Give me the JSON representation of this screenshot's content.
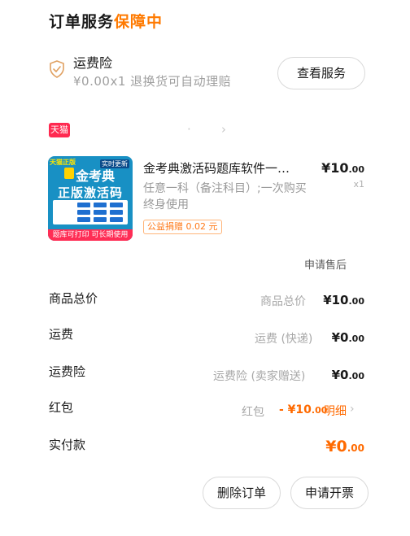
{
  "header": {
    "title_main": "订单服务",
    "title_accent": "保障中"
  },
  "insurance": {
    "name": "运费险",
    "desc": "¥0.00x1 退换货可自动理赔",
    "button": "查看服务",
    "icon": "shield-check-icon"
  },
  "store": {
    "badge": "天猫",
    "name": "·",
    "chevron": "›"
  },
  "product": {
    "image": {
      "tag1": "天猫正版",
      "tag2": "实时更新",
      "brand": "金考典",
      "main": "正版激活码",
      "footer": "题库可打印 可长期使用"
    },
    "title": "金考典激活码题库软件一…",
    "sku": "任意一科（备注科目）;一次购买 终身使用",
    "tag": "公益捐赠 0.02 元",
    "price_int": "¥10",
    "price_dec": ".00",
    "qty": "x1",
    "after_sale": "申请售后"
  },
  "summary": {
    "goods_total": {
      "label": "商品总价",
      "sub": "商品总价",
      "amount_int": "¥10",
      "amount_dec": ".00"
    },
    "shipping": {
      "label": "运费",
      "sub": "运费 (快递)",
      "amount_int": "¥0",
      "amount_dec": ".00"
    },
    "shipping_insurance": {
      "label": "运费险",
      "sub": "运费险 (卖家赠送)",
      "amount_int": "¥0",
      "amount_dec": ".00"
    },
    "red_packet": {
      "label": "红包",
      "sub": "红包",
      "amount_int": "- ¥10",
      "amount_dec": ".00",
      "detail": "明细",
      "chevron": "›"
    },
    "paid": {
      "label": "实付款",
      "amount_int": "¥0",
      "amount_dec": ".00"
    }
  },
  "actions": {
    "delete": "删除订单",
    "invoice": "申请开票"
  },
  "colors": {
    "accent": "#ff7a00",
    "tmall": "#ff2950"
  }
}
